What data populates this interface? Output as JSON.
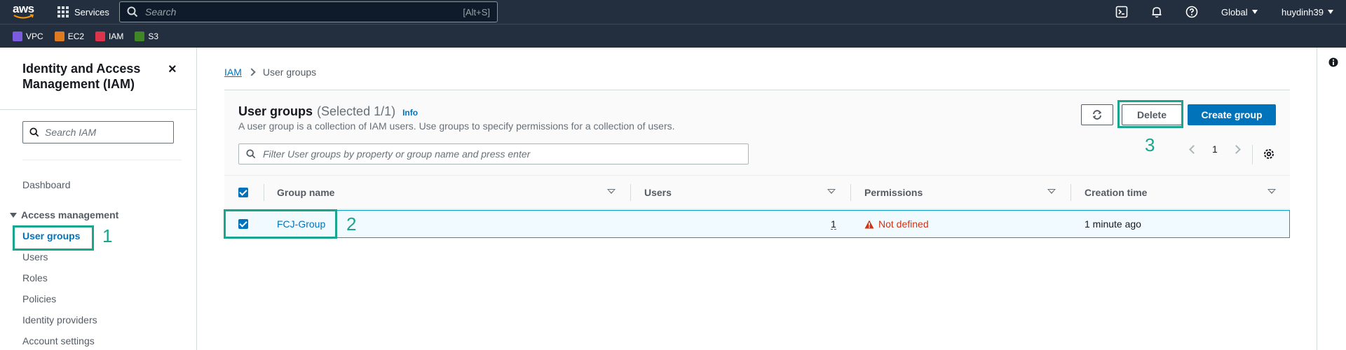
{
  "topnav": {
    "logo": "aws",
    "services_label": "Services",
    "search_placeholder": "Search",
    "search_shortcut": "[Alt+S]",
    "region": "Global",
    "user": "huydinh39"
  },
  "favorites": [
    {
      "label": "VPC",
      "color": "#7b5be0"
    },
    {
      "label": "EC2",
      "color": "#e07a1f"
    },
    {
      "label": "IAM",
      "color": "#dd344c"
    },
    {
      "label": "S3",
      "color": "#3f8624"
    }
  ],
  "sidenav": {
    "title": "Identity and Access Management (IAM)",
    "close_icon": "×",
    "search_placeholder": "Search IAM",
    "dashboard": "Dashboard",
    "section": "Access management",
    "items": [
      "User groups",
      "Users",
      "Roles",
      "Policies",
      "Identity providers",
      "Account settings"
    ]
  },
  "breadcrumb": {
    "root": "IAM",
    "current": "User groups"
  },
  "panel": {
    "title": "User groups",
    "count": "(Selected 1/1)",
    "info": "Info",
    "description": "A user group is a collection of IAM users. Use groups to specify permissions for a collection of users.",
    "filter_placeholder": "Filter User groups by property or group name and press enter",
    "delete_label": "Delete",
    "create_label": "Create group",
    "page": "1"
  },
  "table": {
    "columns": [
      "Group name",
      "Users",
      "Permissions",
      "Creation time"
    ],
    "rows": [
      {
        "group": "FCJ-Group",
        "users": "1",
        "permissions": "Not defined",
        "created": "1 minute ago"
      }
    ]
  },
  "annotations": [
    "1",
    "2",
    "3"
  ],
  "colors": {
    "nav_bg": "#232f3e",
    "link": "#0073bb",
    "annotation": "#1aa58f",
    "warning": "#d13212"
  }
}
